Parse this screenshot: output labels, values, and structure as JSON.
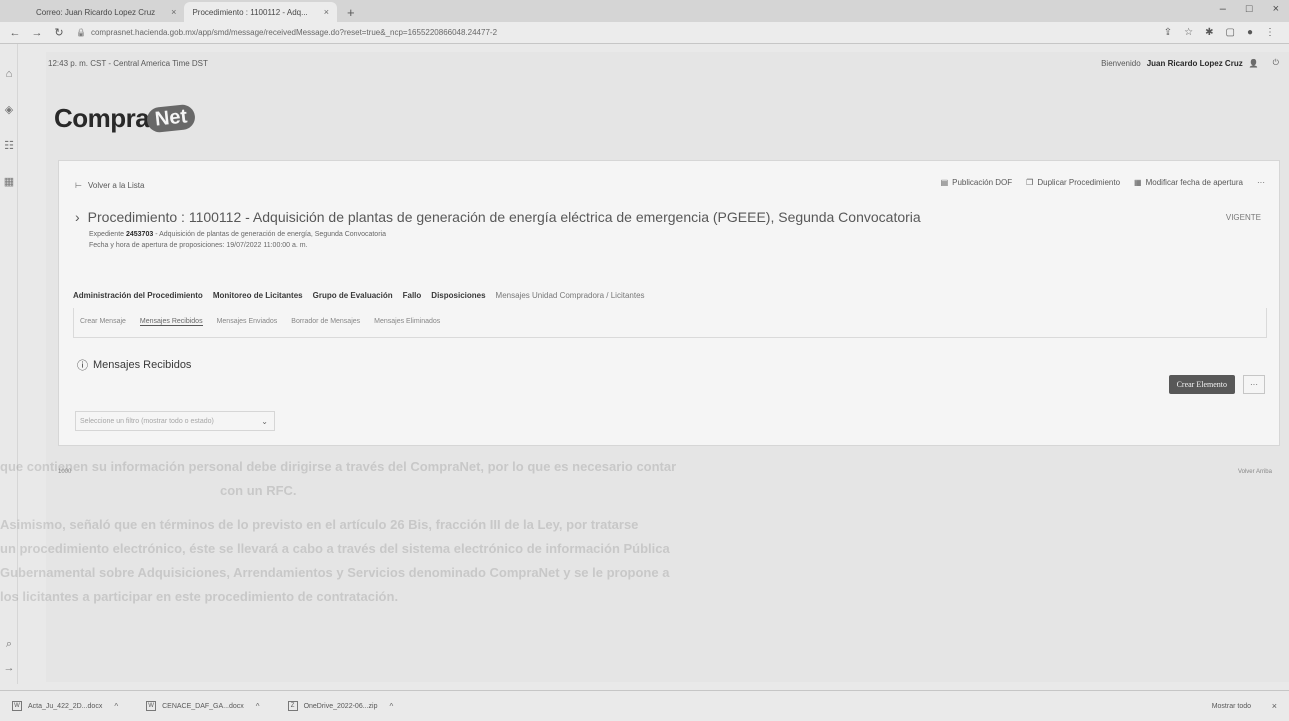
{
  "browser": {
    "tabs": [
      {
        "label": "Correo: Juan Ricardo Lopez Cruz",
        "close": "×"
      },
      {
        "label": "Procedimiento : 1100112 - Adq...",
        "close": "×"
      }
    ],
    "new_tab": "+",
    "url": "comprasnet.hacienda.gob.mx/app/smd/message/receivedMessage.do?reset=true&_ncp=1655220866048.24477-2",
    "window_controls": [
      "–",
      "□",
      "×"
    ]
  },
  "app": {
    "time_zone": "12:43 p. m. CST - Central America Time DST",
    "welcome_prefix": "Bienvenido",
    "user_name": "Juan Ricardo Lopez Cruz",
    "logo_part1": "Compra",
    "logo_part2": "Net"
  },
  "procedure": {
    "back_label": "Volver a la Lista",
    "actions": [
      "Publicación DOF",
      "Duplicar Procedimiento",
      "Modificar fecha de apertura"
    ],
    "more": "···",
    "title": "Procedimiento : 1100112 - Adquisición de plantas de generación de energía eléctrica de emergencia (PGEEE), Segunda Convocatoria",
    "status": "VIGENTE",
    "expediente_label": "Expediente",
    "expediente_number": "2453703",
    "expediente_desc": "- Adquisición de plantas de generación de energía, Segunda Convocatoria",
    "opening_date": "Fecha y hora de apertura de proposiciones: 19/07/2022 11:00:00 a. m."
  },
  "main_tabs": [
    "Administración del Procedimiento",
    "Monitoreo de Licitantes",
    "Grupo de Evaluación",
    "Fallo",
    "Disposiciones",
    "Mensajes Unidad Compradora / Licitantes"
  ],
  "sub_tabs": [
    "Crear Mensaje",
    "Mensajes Recibidos",
    "Mensajes Enviados",
    "Borrador de Mensajes",
    "Mensajes Eliminados"
  ],
  "section": {
    "title": "Mensajes Recibidos",
    "create_button": "Crear Elemento",
    "more_button": "···",
    "select_placeholder": "Seleccione un filtro (mostrar todo o estado)"
  },
  "footer": {
    "left": "1000",
    "right": "Volver Arriba"
  },
  "background_text": [
    "que contienen su información personal debe dirigirse a través del CompraNet, por lo que es necesario contar",
    "con un RFC.",
    "Asimismo, señaló que en términos de lo previsto en el artículo 26 Bis, fracción III de la Ley, por tratarse",
    "un procedimiento electrónico, éste se llevará a cabo a través del sistema electrónico de información Pública",
    "Gubernamental sobre Adquisiciones, Arrendamientos y Servicios denominado CompraNet y se le propone a",
    "los licitantes a participar en este procedimiento de contratación."
  ],
  "downloads": [
    {
      "name": "Acta_Ju_422_2D...docx"
    },
    {
      "name": "CENACE_DAF_GA...docx"
    },
    {
      "name": "OneDrive_2022-06...zip"
    }
  ],
  "downloads_show_all": "Mostrar todo",
  "downloads_close": "×"
}
